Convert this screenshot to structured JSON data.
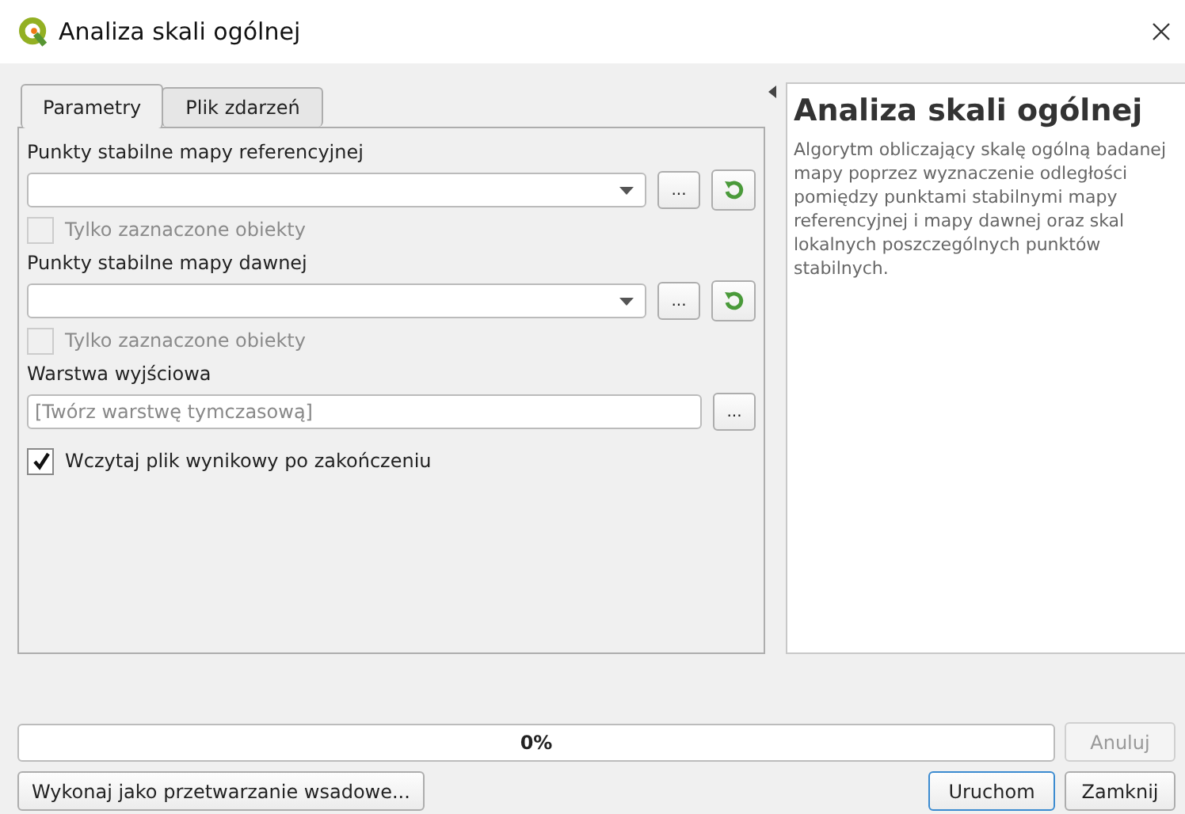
{
  "window": {
    "title": "Analiza skali ogólnej"
  },
  "tabs": [
    {
      "label": "Parametry",
      "selected": true
    },
    {
      "label": "Plik zdarzeń",
      "selected": false
    }
  ],
  "parameters": [
    {
      "kind": "layer",
      "label": "Punkty stabilne mapy referencyjnej",
      "browse": "...",
      "option": {
        "label": "Tylko zaznaczone obiekty",
        "checked": false,
        "disabled": true
      }
    },
    {
      "kind": "layer",
      "label": "Punkty stabilne mapy dawnej",
      "browse": "...",
      "option": {
        "label": "Tylko zaznaczone obiekty",
        "checked": false,
        "disabled": true
      }
    },
    {
      "kind": "output",
      "label": "Warstwa wyjściowa",
      "placeholder": "[Twórz warstwę tymczasową]",
      "browse": "..."
    },
    {
      "kind": "checkbox",
      "label": "Wczytaj plik wynikowy po zakończeniu",
      "checked": true,
      "disabled": false
    }
  ],
  "help": {
    "title": "Analiza skali ogólnej",
    "text": "Algorytm obliczający skalę ogólną badanej mapy poprzez wyznaczenie odległości pomiędzy punktami stabilnymi mapy referencyjnej i mapy dawnej oraz skal lokalnych poszczególnych punktów stabilnych."
  },
  "progress": {
    "level": 0,
    "text": "0%"
  },
  "buttons": [
    {
      "kind": "cancel",
      "label": "Anuluj",
      "disabled": true
    },
    {
      "kind": "batch",
      "label": "Wykonaj jako przetwarzanie wsadowe...",
      "disabled": false
    },
    {
      "kind": "run",
      "label": "Uruchom",
      "disabled": false
    },
    {
      "kind": "close",
      "label": "Zamknij",
      "disabled": false
    }
  ]
}
